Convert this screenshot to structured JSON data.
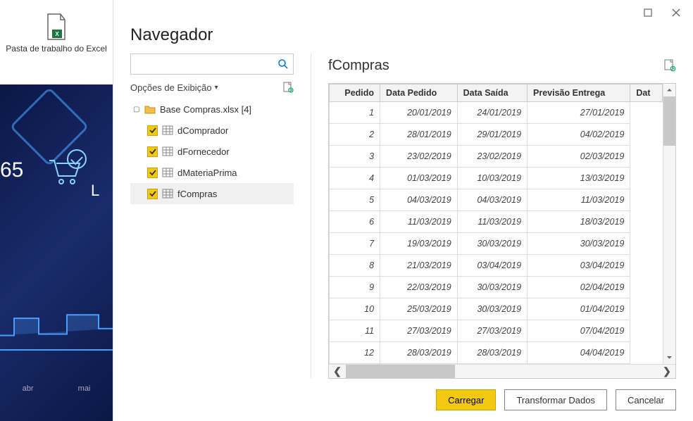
{
  "ribbon": {
    "label": "Pasta de trabalho do Excel"
  },
  "background": {
    "number": "65",
    "letter": "L",
    "months": [
      "abr",
      "mai"
    ]
  },
  "dialog": {
    "title": "Navegador",
    "search_placeholder": "",
    "display_options_label": "Opções de Exibição",
    "tree": {
      "root_label": "Base Compras.xlsx [4]",
      "items": [
        {
          "label": "dComprador"
        },
        {
          "label": "dFornecedor"
        },
        {
          "label": "dMateriaPrima"
        },
        {
          "label": "fCompras"
        }
      ]
    },
    "preview": {
      "title": "fCompras",
      "columns": [
        "Pedido",
        "Data Pedido",
        "Data Saída",
        "Previsão Entrega",
        "Dat"
      ],
      "rows": [
        [
          "1",
          "20/01/2019",
          "24/01/2019",
          "27/01/2019"
        ],
        [
          "2",
          "28/01/2019",
          "29/01/2019",
          "04/02/2019"
        ],
        [
          "3",
          "23/02/2019",
          "23/02/2019",
          "02/03/2019"
        ],
        [
          "4",
          "01/03/2019",
          "10/03/2019",
          "13/03/2019"
        ],
        [
          "5",
          "04/03/2019",
          "04/03/2019",
          "11/03/2019"
        ],
        [
          "6",
          "11/03/2019",
          "11/03/2019",
          "18/03/2019"
        ],
        [
          "7",
          "19/03/2019",
          "30/03/2019",
          "30/03/2019"
        ],
        [
          "8",
          "21/03/2019",
          "03/04/2019",
          "03/04/2019"
        ],
        [
          "9",
          "22/03/2019",
          "30/03/2019",
          "02/04/2019"
        ],
        [
          "10",
          "25/03/2019",
          "30/03/2019",
          "01/04/2019"
        ],
        [
          "11",
          "27/03/2019",
          "27/03/2019",
          "07/04/2019"
        ],
        [
          "12",
          "28/03/2019",
          "28/03/2019",
          "04/04/2019"
        ]
      ]
    },
    "buttons": {
      "load": "Carregar",
      "transform": "Transformar Dados",
      "cancel": "Cancelar"
    }
  }
}
